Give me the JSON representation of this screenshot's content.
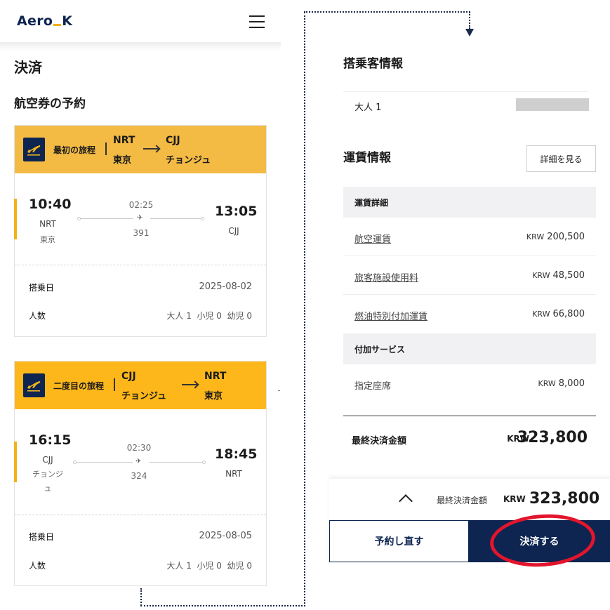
{
  "header": {
    "logo_left": "Aero",
    "logo_right": "K"
  },
  "page": {
    "title": "決済",
    "section_title": "航空券の予約"
  },
  "legs": [
    {
      "label": "最初の旅程",
      "from_code": "NRT",
      "from_city": "東京",
      "to_code": "CJJ",
      "to_city": "チョンジュ",
      "depart_time": "10:40",
      "depart_code": "NRT",
      "depart_city": "東京",
      "duration": "02:25",
      "flight_no": "391",
      "arrive_time": "13:05",
      "arrive_code": "CJJ",
      "date_label": "搭乗日",
      "date": "2025-08-02",
      "pax_label": "人数",
      "pax": "大人 1  小児 0  幼児 0"
    },
    {
      "label": "二度目の旅程",
      "from_code": "CJJ",
      "from_city": "チョンジュ",
      "to_code": "NRT",
      "to_city": "東京",
      "depart_time": "16:15",
      "depart_code": "CJJ",
      "depart_city_line1": "チョンジ",
      "depart_city_line2": "ュ",
      "duration": "02:30",
      "flight_no": "324",
      "arrive_time": "18:45",
      "arrive_code": "NRT",
      "date_label": "搭乗日",
      "date": "2025-08-05",
      "pax_label": "人数",
      "pax": "大人 1  小児 0  幼児 0"
    }
  ],
  "passenger": {
    "title": "搭乗客情報",
    "row_label": "大人 1"
  },
  "fare": {
    "title": "運賃情報",
    "detail_button": "詳細を見る",
    "detail_header": "運賃詳細",
    "detail_rows": [
      {
        "name": "航空運賃",
        "currency": "KRW",
        "amount": "200,500"
      },
      {
        "name": "旅客施設使用料",
        "currency": "KRW",
        "amount": "48,500"
      },
      {
        "name": "燃油特別付加運賃",
        "currency": "KRW",
        "amount": "66,800"
      }
    ],
    "service_header": "付加サービス",
    "service_rows": [
      {
        "name": "指定座席",
        "currency": "KRW",
        "amount": "8,000"
      }
    ],
    "total_label": "最終決済金額",
    "total_currency": "KRW",
    "total_value": "323,800"
  },
  "bottom_bar": {
    "total_label": "最終決済金額",
    "currency": "KRW",
    "value": "323,800",
    "rebook_button": "予約し直す",
    "pay_button": "決済する"
  },
  "colors": {
    "navy": "#0d2550",
    "accent": "#f2b21b",
    "highlight": "#e3152d"
  },
  "icons": {
    "menu": "hamburger-icon",
    "leg": "plane-takeoff-icon",
    "toggle": "chevron-up-icon"
  }
}
